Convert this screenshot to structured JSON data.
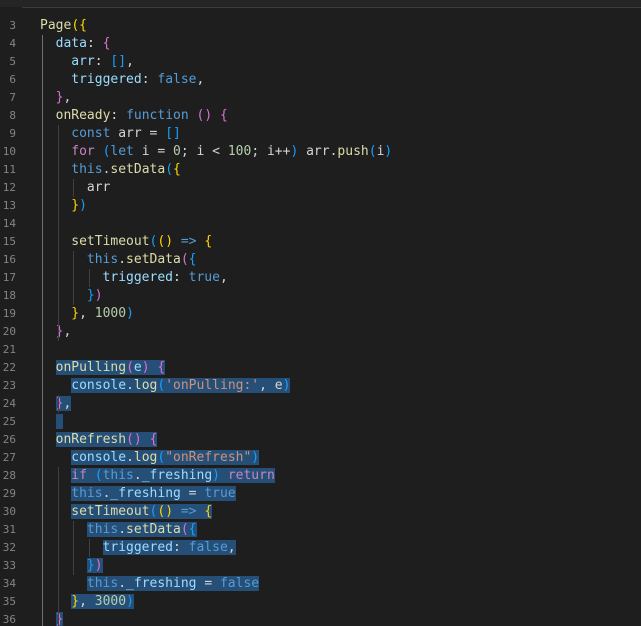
{
  "editor": {
    "lines": [
      {
        "n": 3,
        "indent": 0,
        "tokens": [
          {
            "t": "Page",
            "c": "fn"
          },
          {
            "t": "({",
            "c": "b1"
          }
        ]
      },
      {
        "n": 4,
        "indent": 1,
        "tokens": [
          {
            "t": "data",
            "c": "var"
          },
          {
            "t": ": ",
            "c": "def"
          },
          {
            "t": "{",
            "c": "b2"
          }
        ]
      },
      {
        "n": 5,
        "indent": 2,
        "tokens": [
          {
            "t": "arr",
            "c": "var"
          },
          {
            "t": ": ",
            "c": "def"
          },
          {
            "t": "[]",
            "c": "b3"
          },
          {
            "t": ",",
            "c": "def"
          }
        ]
      },
      {
        "n": 6,
        "indent": 2,
        "tokens": [
          {
            "t": "triggered",
            "c": "var"
          },
          {
            "t": ": ",
            "c": "def"
          },
          {
            "t": "false",
            "c": "bool"
          },
          {
            "t": ",",
            "c": "def"
          }
        ]
      },
      {
        "n": 7,
        "indent": 1,
        "tokens": [
          {
            "t": "}",
            "c": "b2"
          },
          {
            "t": ",",
            "c": "def"
          }
        ]
      },
      {
        "n": 8,
        "indent": 1,
        "tokens": [
          {
            "t": "onReady",
            "c": "fn"
          },
          {
            "t": ": ",
            "c": "def"
          },
          {
            "t": "function",
            "c": "bool"
          },
          {
            "t": " ",
            "c": "def"
          },
          {
            "t": "()",
            "c": "b2"
          },
          {
            "t": " ",
            "c": "def"
          },
          {
            "t": "{",
            "c": "b2"
          }
        ]
      },
      {
        "n": 9,
        "indent": 2,
        "tokens": [
          {
            "t": "const",
            "c": "bool"
          },
          {
            "t": " arr = ",
            "c": "def"
          },
          {
            "t": "[]",
            "c": "b3"
          }
        ]
      },
      {
        "n": 10,
        "indent": 2,
        "tokens": [
          {
            "t": "for",
            "c": "kw"
          },
          {
            "t": " ",
            "c": "def"
          },
          {
            "t": "(",
            "c": "b3"
          },
          {
            "t": "let",
            "c": "bool"
          },
          {
            "t": " i = ",
            "c": "def"
          },
          {
            "t": "0",
            "c": "num"
          },
          {
            "t": "; i < ",
            "c": "def"
          },
          {
            "t": "100",
            "c": "num"
          },
          {
            "t": "; i++",
            "c": "def"
          },
          {
            "t": ")",
            "c": "b3"
          },
          {
            "t": " arr.",
            "c": "def"
          },
          {
            "t": "push",
            "c": "fn"
          },
          {
            "t": "(",
            "c": "b3"
          },
          {
            "t": "i",
            "c": "def"
          },
          {
            "t": ")",
            "c": "b3"
          }
        ]
      },
      {
        "n": 11,
        "indent": 2,
        "tokens": [
          {
            "t": "this",
            "c": "this"
          },
          {
            "t": ".",
            "c": "def"
          },
          {
            "t": "setData",
            "c": "fn"
          },
          {
            "t": "(",
            "c": "b3"
          },
          {
            "t": "{",
            "c": "b1"
          }
        ]
      },
      {
        "n": 12,
        "indent": 3,
        "tokens": [
          {
            "t": "arr",
            "c": "def"
          }
        ]
      },
      {
        "n": 13,
        "indent": 2,
        "tokens": [
          {
            "t": "}",
            "c": "b1"
          },
          {
            "t": ")",
            "c": "b3"
          }
        ]
      },
      {
        "n": 14,
        "indent": 2,
        "tokens": []
      },
      {
        "n": 15,
        "indent": 2,
        "tokens": [
          {
            "t": "setTimeout",
            "c": "fn"
          },
          {
            "t": "(",
            "c": "b3"
          },
          {
            "t": "()",
            "c": "b1"
          },
          {
            "t": " => ",
            "c": "bool"
          },
          {
            "t": "{",
            "c": "b1"
          }
        ]
      },
      {
        "n": 16,
        "indent": 3,
        "tokens": [
          {
            "t": "this",
            "c": "this"
          },
          {
            "t": ".",
            "c": "def"
          },
          {
            "t": "setData",
            "c": "fn"
          },
          {
            "t": "(",
            "c": "b2"
          },
          {
            "t": "{",
            "c": "b3"
          }
        ]
      },
      {
        "n": 17,
        "indent": 4,
        "tokens": [
          {
            "t": "triggered",
            "c": "var"
          },
          {
            "t": ": ",
            "c": "def"
          },
          {
            "t": "true",
            "c": "bool"
          },
          {
            "t": ",",
            "c": "def"
          }
        ]
      },
      {
        "n": 18,
        "indent": 3,
        "tokens": [
          {
            "t": "}",
            "c": "b3"
          },
          {
            "t": ")",
            "c": "b2"
          }
        ]
      },
      {
        "n": 19,
        "indent": 2,
        "tokens": [
          {
            "t": "}",
            "c": "b1"
          },
          {
            "t": ", ",
            "c": "def"
          },
          {
            "t": "1000",
            "c": "num"
          },
          {
            "t": ")",
            "c": "b3"
          }
        ]
      },
      {
        "n": 20,
        "indent": 1,
        "tokens": [
          {
            "t": "}",
            "c": "b2"
          },
          {
            "t": ",",
            "c": "def"
          }
        ]
      },
      {
        "n": 21,
        "indent": 1,
        "tokens": []
      },
      {
        "n": 22,
        "indent": 1,
        "sel": true,
        "tokens": [
          {
            "t": "onPulling",
            "c": "fn"
          },
          {
            "t": "(",
            "c": "b2"
          },
          {
            "t": "e",
            "c": "var"
          },
          {
            "t": ")",
            "c": "b2"
          },
          {
            "t": " ",
            "c": "def"
          },
          {
            "t": "{",
            "c": "b2"
          }
        ]
      },
      {
        "n": 23,
        "indent": 2,
        "sel": true,
        "tokens": [
          {
            "t": "console",
            "c": "var"
          },
          {
            "t": ".",
            "c": "def"
          },
          {
            "t": "log",
            "c": "fn"
          },
          {
            "t": "(",
            "c": "b3"
          },
          {
            "t": "'onPulling:'",
            "c": "str"
          },
          {
            "t": ", e",
            "c": "def"
          },
          {
            "t": ")",
            "c": "b3"
          }
        ]
      },
      {
        "n": 24,
        "indent": 1,
        "sel": true,
        "tokens": [
          {
            "t": "}",
            "c": "b2"
          },
          {
            "t": ",",
            "c": "def"
          }
        ]
      },
      {
        "n": 25,
        "indent": 1,
        "sel": true,
        "tokens": []
      },
      {
        "n": 26,
        "indent": 1,
        "sel": true,
        "tokens": [
          {
            "t": "onRefresh",
            "c": "fn"
          },
          {
            "t": "()",
            "c": "b2"
          },
          {
            "t": " ",
            "c": "def"
          },
          {
            "t": "{",
            "c": "b2"
          }
        ]
      },
      {
        "n": 27,
        "indent": 2,
        "sel": true,
        "tokens": [
          {
            "t": "console",
            "c": "var"
          },
          {
            "t": ".",
            "c": "def"
          },
          {
            "t": "log",
            "c": "fn"
          },
          {
            "t": "(",
            "c": "b3"
          },
          {
            "t": "\"onRefresh\"",
            "c": "str"
          },
          {
            "t": ")",
            "c": "b3"
          }
        ]
      },
      {
        "n": 28,
        "indent": 2,
        "sel": true,
        "tokens": [
          {
            "t": "if",
            "c": "kw"
          },
          {
            "t": " ",
            "c": "def"
          },
          {
            "t": "(",
            "c": "b3"
          },
          {
            "t": "this",
            "c": "this"
          },
          {
            "t": ".",
            "c": "def"
          },
          {
            "t": "_freshing",
            "c": "var"
          },
          {
            "t": ")",
            "c": "b3"
          },
          {
            "t": " ",
            "c": "def"
          },
          {
            "t": "return",
            "c": "kw"
          }
        ]
      },
      {
        "n": 29,
        "indent": 2,
        "sel": true,
        "tokens": [
          {
            "t": "this",
            "c": "this"
          },
          {
            "t": ".",
            "c": "def"
          },
          {
            "t": "_freshing",
            "c": "var"
          },
          {
            "t": " = ",
            "c": "def"
          },
          {
            "t": "true",
            "c": "bool"
          }
        ]
      },
      {
        "n": 30,
        "indent": 2,
        "sel": true,
        "tokens": [
          {
            "t": "setTimeout",
            "c": "fn"
          },
          {
            "t": "(",
            "c": "b3"
          },
          {
            "t": "()",
            "c": "b1"
          },
          {
            "t": " => ",
            "c": "bool"
          },
          {
            "t": "{",
            "c": "b1"
          }
        ]
      },
      {
        "n": 31,
        "indent": 3,
        "sel": true,
        "tokens": [
          {
            "t": "this",
            "c": "this"
          },
          {
            "t": ".",
            "c": "def"
          },
          {
            "t": "setData",
            "c": "fn"
          },
          {
            "t": "(",
            "c": "b2"
          },
          {
            "t": "{",
            "c": "b3"
          }
        ]
      },
      {
        "n": 32,
        "indent": 4,
        "sel": true,
        "tokens": [
          {
            "t": "triggered",
            "c": "var"
          },
          {
            "t": ": ",
            "c": "def"
          },
          {
            "t": "false",
            "c": "bool"
          },
          {
            "t": ",",
            "c": "def"
          }
        ]
      },
      {
        "n": 33,
        "indent": 3,
        "sel": true,
        "tokens": [
          {
            "t": "}",
            "c": "b3"
          },
          {
            "t": ")",
            "c": "b2"
          }
        ]
      },
      {
        "n": 34,
        "indent": 3,
        "sel": true,
        "tokens": [
          {
            "t": "this",
            "c": "this"
          },
          {
            "t": ".",
            "c": "def"
          },
          {
            "t": "_freshing",
            "c": "var"
          },
          {
            "t": " = ",
            "c": "def"
          },
          {
            "t": "false",
            "c": "bool"
          }
        ]
      },
      {
        "n": 35,
        "indent": 2,
        "sel": true,
        "tokens": [
          {
            "t": "}",
            "c": "b1"
          },
          {
            "t": ", ",
            "c": "def"
          },
          {
            "t": "3000",
            "c": "num"
          },
          {
            "t": ")",
            "c": "b3"
          }
        ]
      },
      {
        "n": 36,
        "indent": 1,
        "sel": true,
        "tokens": [
          {
            "t": "}",
            "c": "b2"
          }
        ]
      }
    ]
  }
}
